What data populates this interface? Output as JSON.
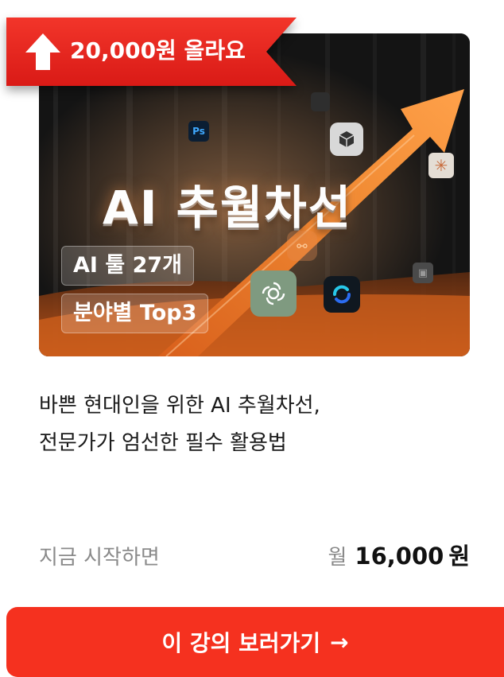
{
  "badge": {
    "text": "20,000원 올라요",
    "icon": "up-arrow-icon"
  },
  "hero": {
    "title": "AI 추월차선",
    "tags": [
      "AI 툴 27개",
      "분야별 Top3"
    ],
    "icons": [
      "photoshop-icon",
      "cube-icon",
      "asterisk-icon",
      "flow-icon",
      "chatgpt-icon",
      "loop-icon",
      "box-icon",
      "square-icon"
    ]
  },
  "description": {
    "line1": "바쁜 현대인을 위한 AI 추월차선,",
    "line2": "전문가가 엄선한 필수 활용법"
  },
  "pricing": {
    "start_label": "지금 시작하면",
    "unit": "월",
    "amount": "16,000",
    "currency": "원"
  },
  "cta": {
    "label": "이 강의 보러가기",
    "arrow": "→"
  },
  "colors": {
    "accent": "#f5311f",
    "ribbon": "#e8261c",
    "orange": "#f07a2a"
  }
}
